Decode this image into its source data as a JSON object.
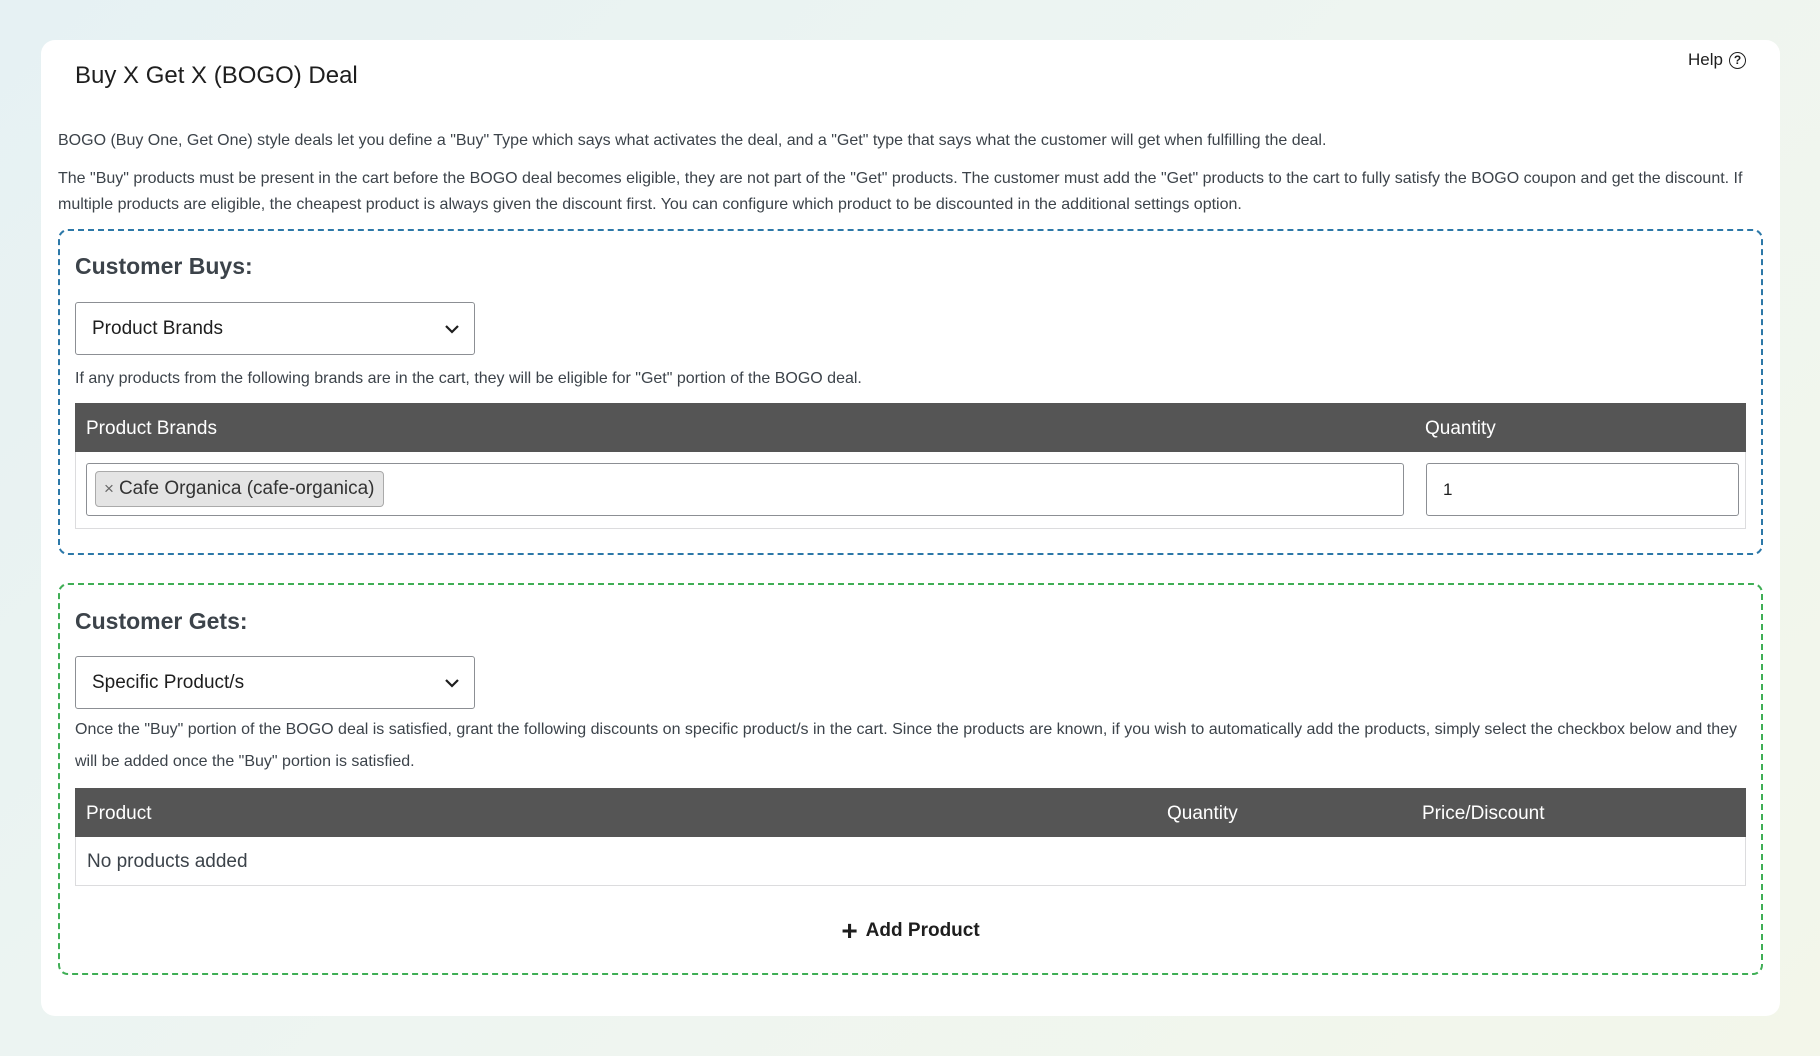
{
  "panel": {
    "title": "Buy X Get X (BOGO) Deal",
    "help_label": "Help",
    "help_icon": "?",
    "description_1": "BOGO (Buy One, Get One) style deals let you define a \"Buy\" Type which says what activates the deal, and a \"Get\" type that says what the customer will get when fulfilling the deal.",
    "description_2": "The \"Buy\" products must be present in the cart before the BOGO deal becomes eligible, they are not part of the \"Get\" products. The customer must add the \"Get\" products to the cart to fully satisfy the BOGO coupon and get the discount. If multiple products are eligible, the cheapest product is always given the discount first. You can configure which product to be discounted in the additional settings option."
  },
  "buys": {
    "title": "Customer Buys:",
    "select_value": "Product Brands",
    "note": "If any products from the following brands are in the cart, they will be eligible for \"Get\" portion of the BOGO deal.",
    "columns": [
      "Product Brands",
      "Quantity"
    ],
    "tag_remove": "×",
    "tag_label": "Cafe Organica (cafe-organica)",
    "quantity": "1"
  },
  "gets": {
    "title": "Customer Gets:",
    "select_value": "Specific Product/s",
    "note": "Once the \"Buy\" portion of the BOGO deal is satisfied, grant the following discounts on specific product/s in the cart. Since the products are known, if you wish to automatically add the products, simply select the checkbox below and they will be added once the \"Buy\" portion is satisfied.",
    "columns": [
      "Product",
      "Quantity",
      "Price/Discount"
    ],
    "empty_text": "No products added",
    "add_icon": "+",
    "add_label": "Add Product"
  }
}
